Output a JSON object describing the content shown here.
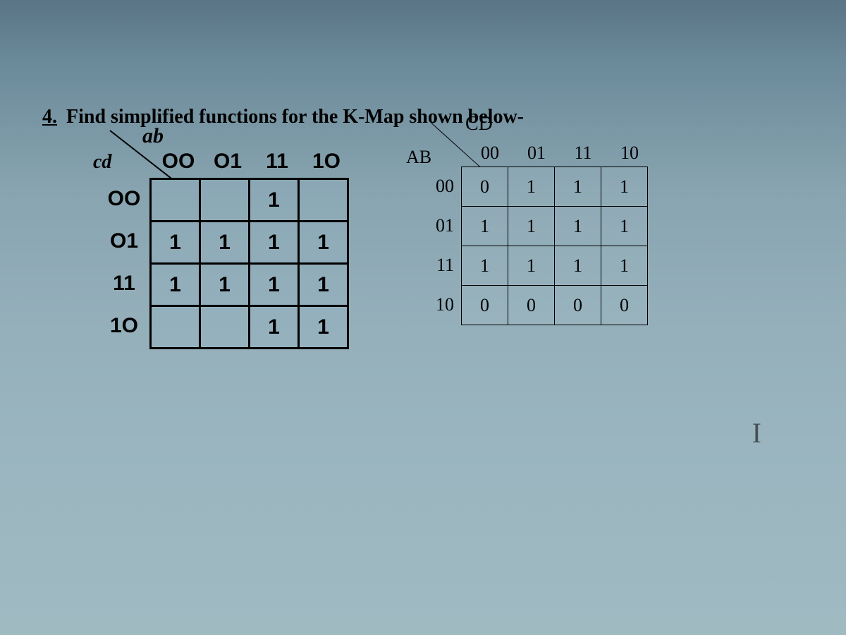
{
  "question": {
    "number": "4.",
    "text": "Find simplified functions for the K-Map shown below-"
  },
  "kmap_left": {
    "top_var": "ab",
    "side_var": "cd",
    "col_headers": [
      "OO",
      "O1",
      "11",
      "1O"
    ],
    "row_headers": [
      "OO",
      "O1",
      "11",
      "1O"
    ],
    "cells": [
      [
        "",
        "",
        "1",
        ""
      ],
      [
        "1",
        "1",
        "1",
        "1"
      ],
      [
        "1",
        "1",
        "1",
        "1"
      ],
      [
        "",
        "",
        "1",
        "1"
      ]
    ]
  },
  "kmap_right": {
    "top_var": "CD",
    "side_var": "AB",
    "col_headers": [
      "00",
      "01",
      "11",
      "10"
    ],
    "row_headers": [
      "00",
      "01",
      "11",
      "10"
    ],
    "cells": [
      [
        "0",
        "1",
        "1",
        "1"
      ],
      [
        "1",
        "1",
        "1",
        "1"
      ],
      [
        "1",
        "1",
        "1",
        "1"
      ],
      [
        "0",
        "0",
        "0",
        "0"
      ]
    ]
  },
  "cursor": "I"
}
